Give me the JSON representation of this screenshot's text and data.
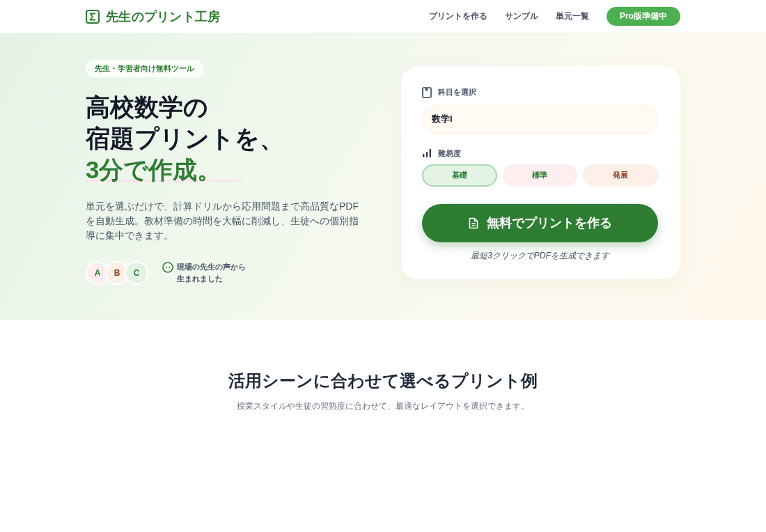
{
  "header": {
    "logo": "先生のプリント工房",
    "nav": [
      {
        "label": "プリントを作る"
      },
      {
        "label": "サンプル"
      },
      {
        "label": "単元一覧"
      }
    ],
    "cta": "Pro版準備中"
  },
  "hero": {
    "badge": "先生・学習者向け無料ツール",
    "headline": [
      "高校数学の",
      "宿題プリントを、"
    ],
    "headline_accent": "3分で作成。",
    "description": "単元を選ぶだけで、計算ドリルから応用問題まで高品質なPDFを自動生成。教材準備の時間を大幅に削減し、生徒への個別指導に集中できます。",
    "avatars": [
      {
        "initial": "A",
        "color": "#2e7d32"
      },
      {
        "initial": "B",
        "color": "#8d3b1f"
      },
      {
        "initial": "C",
        "color": "#2e7d32"
      }
    ],
    "testimonial": "現場の先生の声から生まれました"
  },
  "form": {
    "subject": {
      "label": "科目を選択",
      "value": "数学I"
    },
    "difficulty": {
      "label": "難易度",
      "options": [
        {
          "label": "基礎",
          "selected": true,
          "color": "#2e7d32"
        },
        {
          "label": "標準",
          "selected": false,
          "color": "#2e7d32"
        },
        {
          "label": "発展",
          "selected": false,
          "color": "#8d3b1f"
        }
      ]
    },
    "submit": "無料でプリントを作る",
    "note": "最短3クリックでPDFを生成できます"
  },
  "examples": {
    "title": "活用シーンに合わせて選べるプリント例",
    "subtitle": "授業スタイルや生徒の習熟度に合わせて、最適なレイアウトを選択できます。"
  }
}
